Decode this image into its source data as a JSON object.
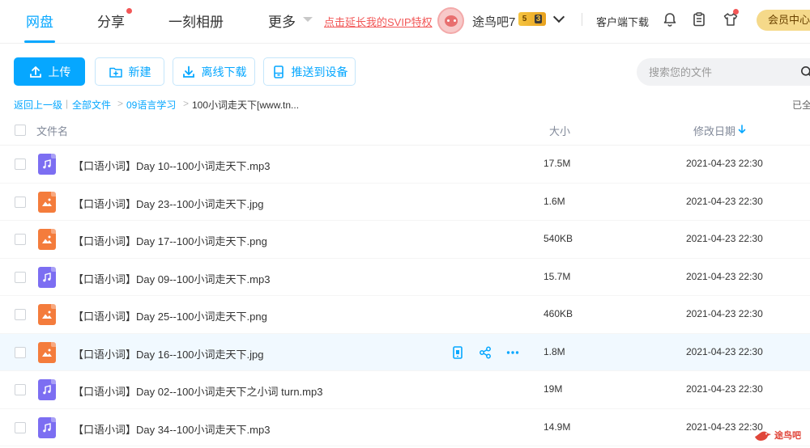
{
  "nav": {
    "items": [
      "网盘",
      "分享",
      "一刻相册",
      "更多"
    ],
    "promo": "点击延长我的SVIP特权",
    "username": "途鸟吧7",
    "vip_level": "5",
    "vip_sub": "3",
    "client_download": "客户端下载",
    "member_center": "会员中心"
  },
  "toolbar": {
    "upload": "上传",
    "new": "新建",
    "offline_download": "离线下载",
    "push_to_device": "推送到设备",
    "search_placeholder": "搜索您的文件"
  },
  "breadcrumb": {
    "back": "返回上一级",
    "all_files": "全部文件",
    "folder": "09语言学习",
    "current": "100小词走天下[www.tn...",
    "right_status": "已全"
  },
  "table": {
    "col_name": "文件名",
    "col_size": "大小",
    "col_date": "修改日期",
    "rows": [
      {
        "name": "【口语小词】Day 10--100小词走天下.mp3",
        "size": "17.5M",
        "date": "2021-04-23 22:30",
        "type": "audio"
      },
      {
        "name": "【口语小词】Day 23--100小词走天下.jpg",
        "size": "1.6M",
        "date": "2021-04-23 22:30",
        "type": "image"
      },
      {
        "name": "【口语小词】Day 17--100小词走天下.png",
        "size": "540KB",
        "date": "2021-04-23 22:30",
        "type": "image"
      },
      {
        "name": "【口语小词】Day 09--100小词走天下.mp3",
        "size": "15.7M",
        "date": "2021-04-23 22:30",
        "type": "audio"
      },
      {
        "name": "【口语小词】Day 25--100小词走天下.png",
        "size": "460KB",
        "date": "2021-04-23 22:30",
        "type": "image"
      },
      {
        "name": "【口语小词】Day 16--100小词走天下.jpg",
        "size": "1.8M",
        "date": "2021-04-23 22:30",
        "type": "image"
      },
      {
        "name": "【口语小词】Day 02--100小词走天下之小词 turn.mp3",
        "size": "19M",
        "date": "2021-04-23 22:30",
        "type": "audio"
      },
      {
        "name": "【口语小词】Day 34--100小词走天下.mp3",
        "size": "14.9M",
        "date": "2021-04-23 22:30",
        "type": "audio"
      }
    ]
  },
  "watermark": "途鸟吧",
  "colors": {
    "accent": "#06a7ff",
    "promo": "#f25656",
    "audio_icon": "#7c6ef2",
    "image_icon": "#f47c3c",
    "hover_row": "#f1f9ff"
  }
}
